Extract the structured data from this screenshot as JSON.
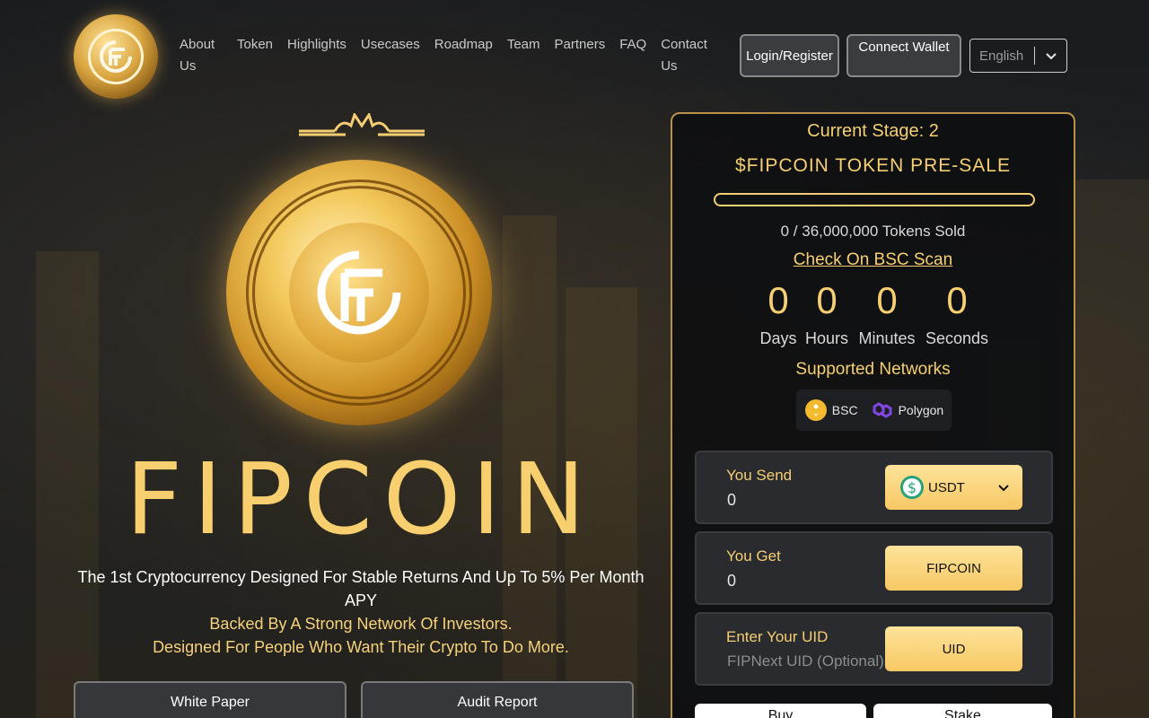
{
  "nav": {
    "items": [
      "About Us",
      "Token",
      "Highlights",
      "Usecases",
      "Roadmap",
      "Team",
      "Partners",
      "FAQ",
      "Contact Us"
    ],
    "login_label": "Login/Register",
    "connect_label": "Connect Wallet",
    "language": "English"
  },
  "hero": {
    "title": "FIPCOIN",
    "tagline": "The 1st Cryptocurrency Designed For Stable Returns And Up To 5% Per Month APY",
    "sub1": "Backed By A Strong Network Of Investors.",
    "sub2": "Designed For People Who Want Their Crypto To Do More.",
    "buttons": [
      "White Paper",
      "Audit Report"
    ]
  },
  "presale": {
    "stage": "Current Stage: 2",
    "title": "$FIPCOIN TOKEN PRE-SALE",
    "progress": 0,
    "sold": "0 / 36,000,000 Tokens Sold",
    "scan_link": "Check On BSC Scan",
    "countdown": [
      {
        "value": "0",
        "label": "Days"
      },
      {
        "value": "0",
        "label": "Hours"
      },
      {
        "value": "0",
        "label": "Minutes"
      },
      {
        "value": "0",
        "label": "Seconds"
      }
    ],
    "networks_title": "Supported Networks",
    "networks": [
      "BSC",
      "Polygon"
    ],
    "send": {
      "label": "You Send",
      "value": "0",
      "token": "USDT"
    },
    "get": {
      "label": "You Get",
      "value": "0",
      "token": "FIPCOIN"
    },
    "uid": {
      "label": "Enter Your UID",
      "placeholder": "FIPNext UID (Optional)",
      "button": "UID"
    },
    "actions": [
      "Buy",
      "Stake"
    ]
  },
  "colors": {
    "gold": "#f5cf72",
    "background": "#1d2024"
  },
  "icons": {
    "chevron": "chevron-down-icon",
    "bsc": "bsc-icon",
    "polygon": "polygon-icon",
    "usdt": "usdt-icon"
  }
}
